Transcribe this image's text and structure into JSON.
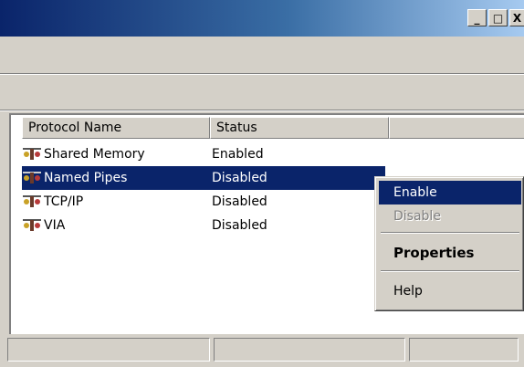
{
  "window": {
    "minimize": "_",
    "maximize": "□",
    "close": "X"
  },
  "list": {
    "columns": [
      "Protocol Name",
      "Status",
      ""
    ],
    "rows": [
      {
        "name": "Shared Memory",
        "status": "Enabled",
        "icon": "protocol-icon"
      },
      {
        "name": "Named Pipes",
        "status": "Disabled",
        "icon": "protocol-icon",
        "selected": true
      },
      {
        "name": "TCP/IP",
        "status": "Disabled",
        "icon": "protocol-icon"
      },
      {
        "name": "VIA",
        "status": "Disabled",
        "icon": "protocol-icon"
      }
    ]
  },
  "context_menu": {
    "enable": "Enable",
    "disable": "Disable",
    "properties": "Properties",
    "help": "Help"
  },
  "colors": {
    "selection": "#0a246a",
    "face": "#d4d0c8"
  }
}
